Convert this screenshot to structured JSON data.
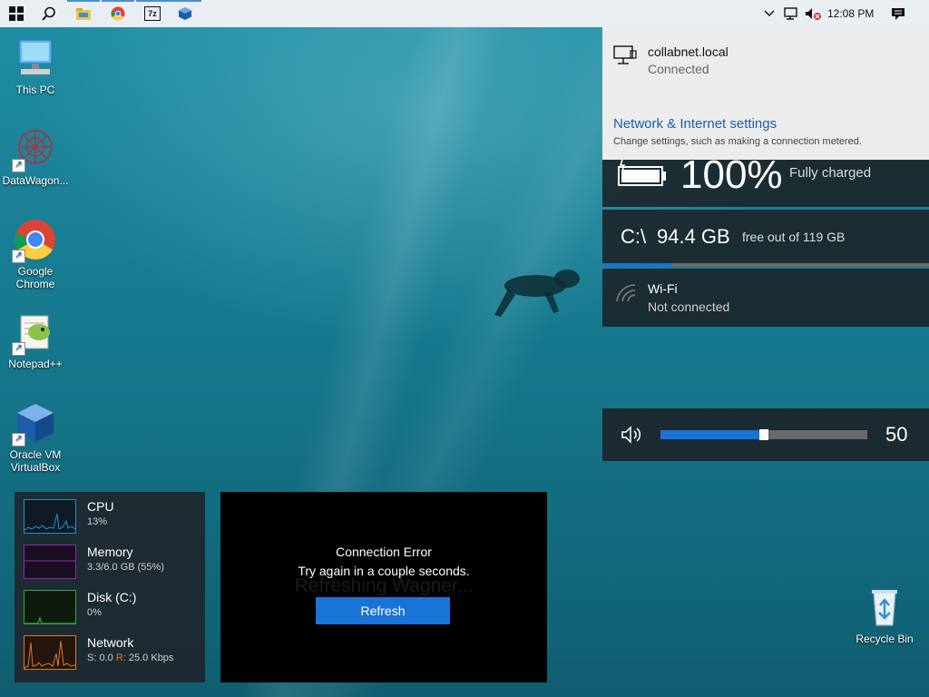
{
  "taskbar": {
    "clock": "12:08 PM",
    "icons": [
      "windows-start-icon",
      "search-icon",
      "file-explorer-icon",
      "chrome-icon",
      "7zip-icon",
      "virtualbox-icon"
    ],
    "seven_zip_label": "7z"
  },
  "desktop": {
    "icons": [
      {
        "label": "This PC"
      },
      {
        "label": "DataWagon..."
      },
      {
        "label": "Google Chrome"
      },
      {
        "label": "Notepad++"
      },
      {
        "label": "Oracle VM VirtualBox"
      },
      {
        "label": "Recycle Bin"
      }
    ]
  },
  "network_flyout": {
    "network_name": "collabnet.local",
    "network_status": "Connected",
    "settings_link": "Network & Internet settings",
    "settings_desc": "Change settings, such as making a connection metered."
  },
  "battery": {
    "percent": "100%",
    "status": "Fully charged"
  },
  "disk": {
    "drive": "C:\\",
    "free": "94.4 GB",
    "total_text": "free out of 119 GB",
    "used_fraction": 0.21
  },
  "wifi": {
    "label": "Wi-Fi",
    "status": "Not connected"
  },
  "volume": {
    "value": "50",
    "fraction": 0.5
  },
  "monitor": {
    "cpu": {
      "title": "CPU",
      "value": "13%"
    },
    "memory": {
      "title": "Memory",
      "value": "3.3/6.0 GB (55%)"
    },
    "disk": {
      "title": "Disk (C:)",
      "value": "0%"
    },
    "network": {
      "title": "Network",
      "s_label": "S:",
      "s_value": "0.0",
      "r_label": "R:",
      "r_value": "25.0 Kbps"
    }
  },
  "error_widget": {
    "ghost_text": "Refreshing Wagner...",
    "title": "Connection Error",
    "message": "Try again in a couple seconds.",
    "button": "Refresh"
  },
  "colors": {
    "accent": "#1a73d6",
    "cpu": "#2a8fd0",
    "memory": "#8a2aa8",
    "disk": "#3aa83a",
    "network": "#e07a2a"
  }
}
